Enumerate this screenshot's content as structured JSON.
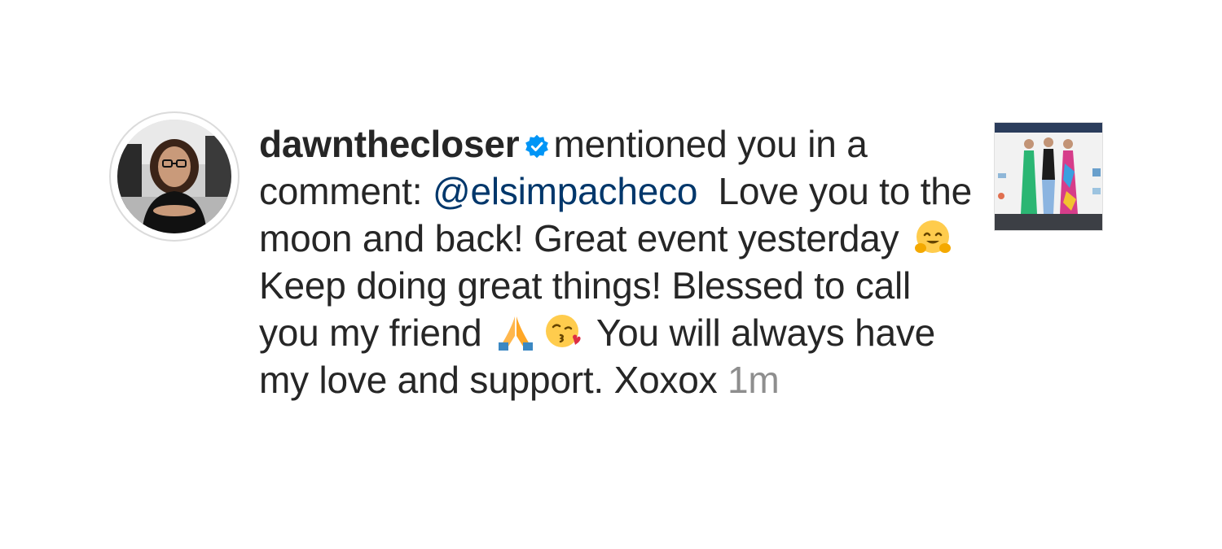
{
  "notification": {
    "username": "dawnthecloser",
    "verified": true,
    "action_text": "mentioned you in a comment:",
    "mention": "@elsimpacheco",
    "comment_part1": "Love you to the moon and back! Great event yesterday",
    "emoji_1": "hugging-face-emoji",
    "comment_part2": "Keep doing great things! Blessed to call you my friend",
    "emoji_2": "folded-hands-emoji",
    "emoji_3": "face-blowing-kiss-emoji",
    "comment_part3": "You will always have my love and support. Xoxox",
    "timestamp": "1m"
  },
  "colors": {
    "text": "#262626",
    "mention": "#00376b",
    "timestamp": "#8e8e8e",
    "verified_badge": "#0095f6",
    "background": "#ffffff"
  }
}
